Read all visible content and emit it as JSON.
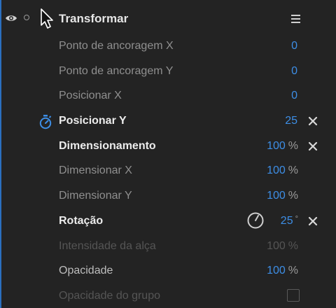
{
  "header": {
    "title": "Transformar",
    "icons": [
      "eye-icon",
      "dot-icon",
      "cursor-icon",
      "menu-icon"
    ]
  },
  "properties": [
    {
      "label": "Ponto de ancoragem X",
      "value": "0",
      "unit": "",
      "state": "dim"
    },
    {
      "label": "Ponto de ancoragem Y",
      "value": "0",
      "unit": "",
      "state": "dim"
    },
    {
      "label": "Posicionar X",
      "value": "0",
      "unit": "",
      "state": "dim"
    },
    {
      "label": "Posicionar Y",
      "value": "25",
      "unit": "",
      "state": "active",
      "keyframed": true,
      "resettable": true
    },
    {
      "label": "Dimensionamento",
      "value": "100",
      "unit": "%",
      "state": "active",
      "resettable": true
    },
    {
      "label": "Dimensionar X",
      "value": "100",
      "unit": "%",
      "state": "dim"
    },
    {
      "label": "Dimensionar Y",
      "value": "100",
      "unit": "%",
      "state": "dim"
    },
    {
      "label": "Rotação",
      "value": "25",
      "unit": "°",
      "state": "active",
      "dial": true,
      "resettable": true
    },
    {
      "label": "Intensidade da alça",
      "value": "100",
      "unit": "%",
      "state": "disabled"
    },
    {
      "label": "Opacidade",
      "value": "100",
      "unit": "%",
      "state": "active"
    },
    {
      "label": "Opacidade do grupo",
      "checked": false,
      "state": "disabled"
    }
  ],
  "colors": {
    "background": "#232323",
    "accent": "#3d8ee6",
    "label_active": "#ececec",
    "label_dim": "#8f8f8f",
    "label_disabled": "#555555"
  }
}
